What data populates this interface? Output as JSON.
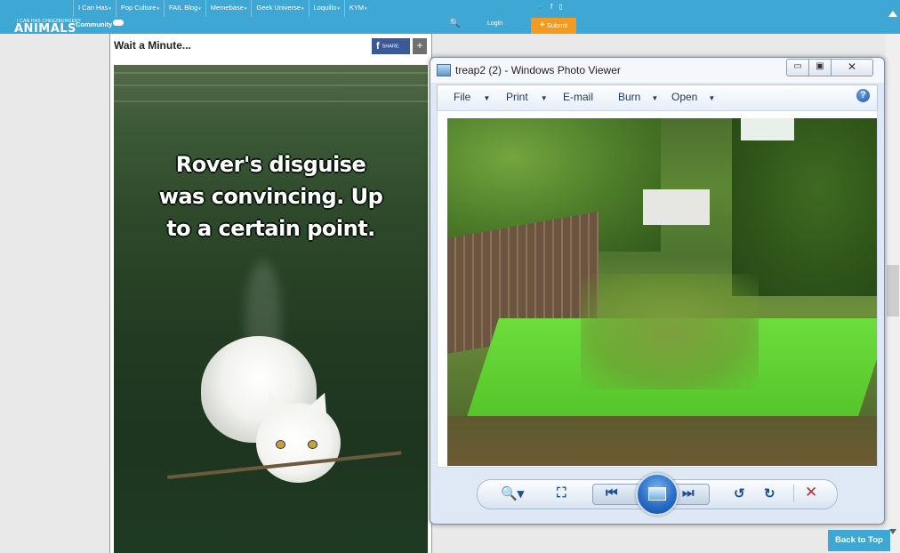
{
  "site": {
    "brand_small": "I CAN HAS CHEEZBURGER?",
    "brand_big": "ANIMALS",
    "community_label": "Community",
    "nav": [
      {
        "label": "I Can Has"
      },
      {
        "label": "Pop Culture"
      },
      {
        "label": "FAIL Blog"
      },
      {
        "label": "Memebase"
      },
      {
        "label": "Geek Universe"
      },
      {
        "label": "Loquillo"
      },
      {
        "label": "KYM"
      }
    ],
    "nav_caret": "▾",
    "social": [
      "twitter-icon",
      "facebook-icon",
      "mobile-icon"
    ],
    "social_glyphs": [
      "🐦",
      "f",
      "▯"
    ],
    "search_glyph": "🔍",
    "login_label": "Login",
    "submit_label": "Submit",
    "submit_plus": "+",
    "accent": "#3ea7d4",
    "submit_color": "#f39a1f"
  },
  "post": {
    "title": "Wait a Minute...",
    "share_label": "SHARE",
    "share_f": "f",
    "more_label": "+",
    "meme_lines": [
      "Rover's disguise",
      "was convincing. Up",
      "to a certain point."
    ]
  },
  "viewer": {
    "title": "treap2 (2) - Windows Photo Viewer",
    "min_glyph": "▭",
    "max_glyph": "▣",
    "close_glyph": "✕",
    "menus": [
      "File",
      "Print",
      "E-mail",
      "Burn",
      "Open"
    ],
    "menu_dropdown": [
      true,
      true,
      false,
      true,
      true
    ],
    "dd_glyph": "▼",
    "help_glyph": "?",
    "controls": {
      "zoom": "🔍▾",
      "fit": "⛶",
      "prev": "⏮",
      "next": "⏭",
      "rotate_ccw": "↺",
      "rotate_cw": "↻",
      "delete": "✕"
    }
  },
  "page": {
    "back_to_top": "Back to Top"
  }
}
